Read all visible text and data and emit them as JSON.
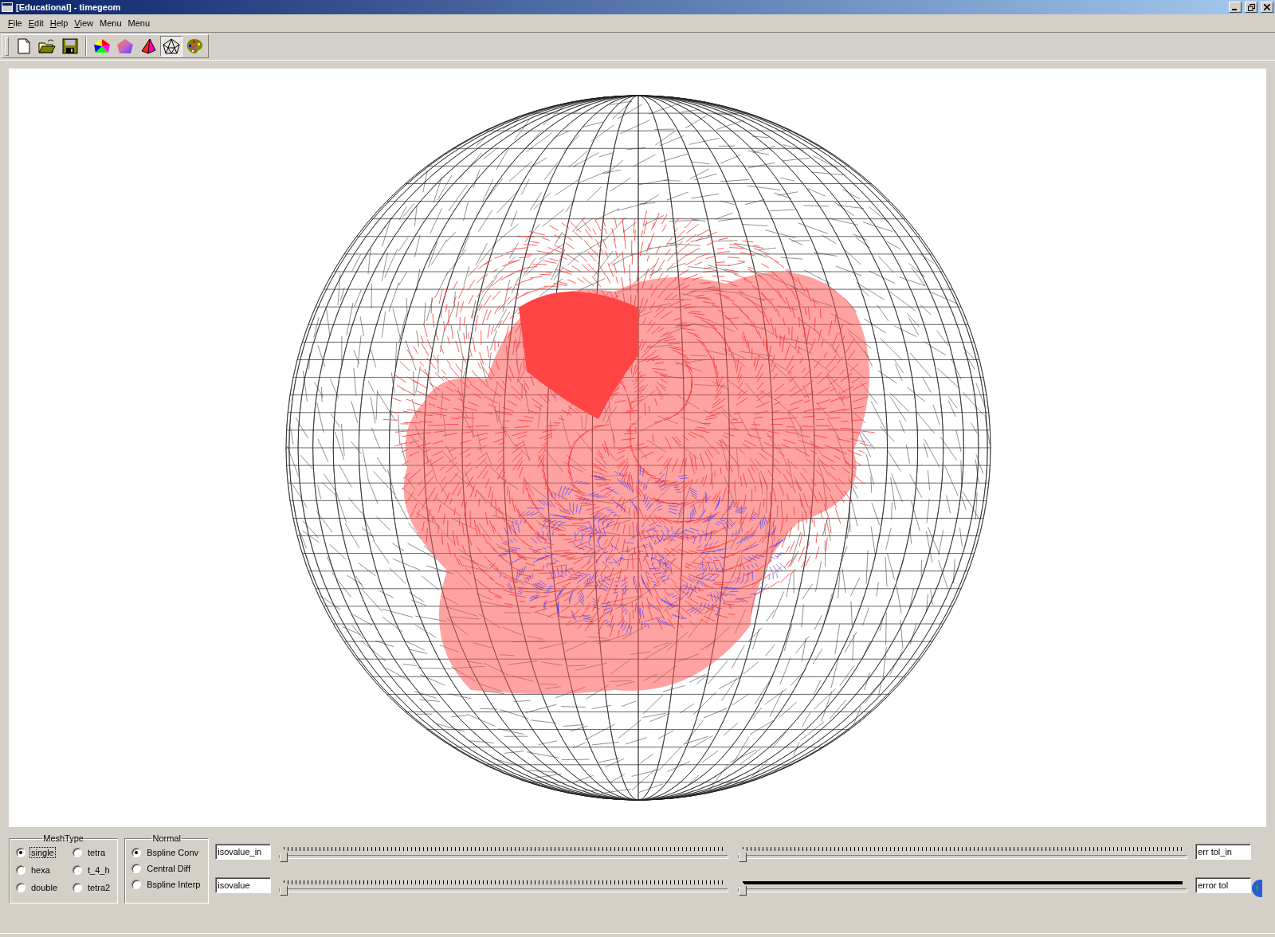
{
  "window": {
    "title": "[Educational] - timegeom"
  },
  "menu": [
    {
      "label": "File",
      "mnemonic": true
    },
    {
      "label": "Edit",
      "mnemonic": true
    },
    {
      "label": "Help",
      "mnemonic": true
    },
    {
      "label": "View",
      "mnemonic": true
    },
    {
      "label": "Menu",
      "mnemonic": false
    },
    {
      "label": "Menu",
      "mnemonic": false
    }
  ],
  "toolbar": [
    {
      "kind": "new",
      "selected": false
    },
    {
      "kind": "open",
      "selected": false
    },
    {
      "kind": "save",
      "selected": false
    },
    {
      "kind": "colors",
      "selected": false
    },
    {
      "kind": "gradient",
      "selected": false
    },
    {
      "kind": "pyramid",
      "selected": false
    },
    {
      "kind": "wireframe",
      "selected": true
    },
    {
      "kind": "palette",
      "selected": false
    }
  ],
  "mesh_type": {
    "title": "MeshType",
    "options": [
      {
        "label": "single",
        "selected": true
      },
      {
        "label": "tetra",
        "selected": false
      },
      {
        "label": "hexa",
        "selected": false
      },
      {
        "label": "t_4_h",
        "selected": false
      },
      {
        "label": "double",
        "selected": false
      },
      {
        "label": "tetra2",
        "selected": false
      }
    ]
  },
  "normal": {
    "title": "Normal",
    "options": [
      {
        "label": "Bspline Conv",
        "selected": true
      },
      {
        "label": "Central Diff",
        "selected": false
      },
      {
        "label": "Bspline Interp",
        "selected": false
      }
    ]
  },
  "rows": [
    {
      "left_value": "isovalue_in",
      "sliders": [
        {
          "kind": "ticks",
          "level": 0
        },
        {
          "kind": "ticks",
          "level": 0
        }
      ],
      "right_value": "err tol_in"
    },
    {
      "left_value": "isovalue",
      "sliders": [
        {
          "kind": "ticks",
          "level": 0
        },
        {
          "kind": "range",
          "level": 0
        }
      ],
      "right_value": "error tol"
    }
  ]
}
